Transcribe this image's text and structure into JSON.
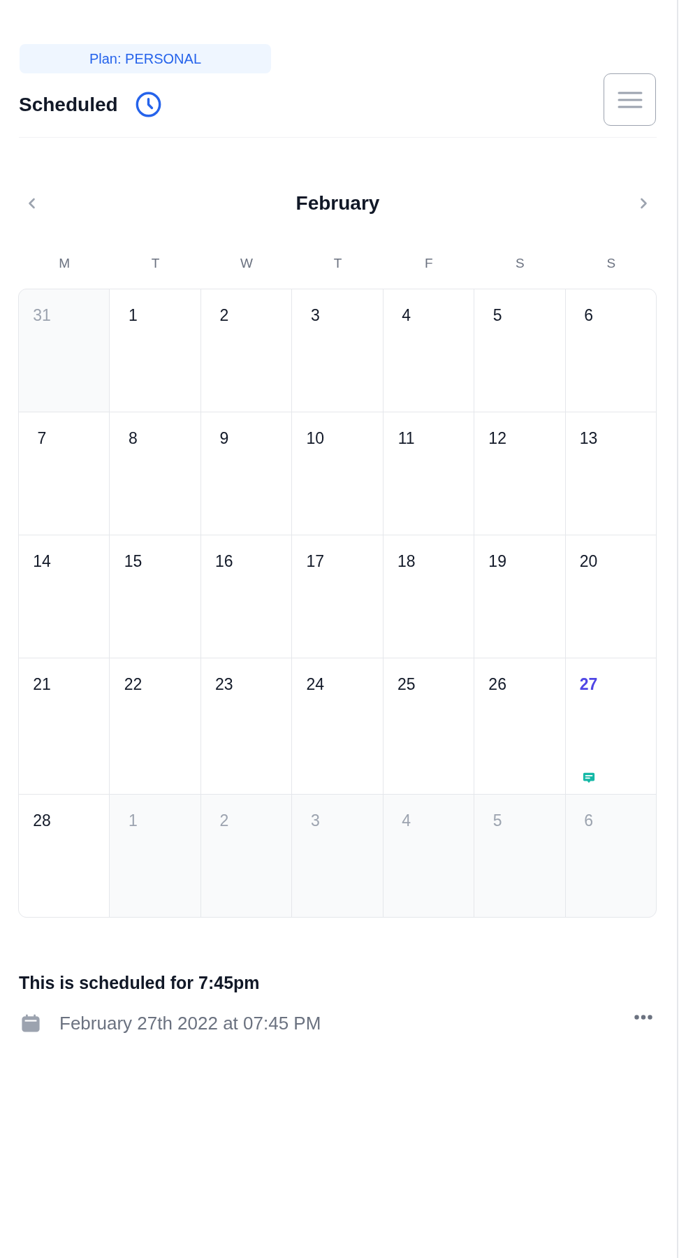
{
  "plan_badge": {
    "label": "Plan: PERSONAL"
  },
  "header": {
    "title": "Scheduled"
  },
  "calendar": {
    "month": "February",
    "weekdays": [
      "M",
      "T",
      "W",
      "T",
      "F",
      "S",
      "S"
    ],
    "weeks": [
      [
        {
          "day": "31",
          "in_month": false,
          "selected": false,
          "has_event": false
        },
        {
          "day": "1",
          "in_month": true,
          "selected": false,
          "has_event": false
        },
        {
          "day": "2",
          "in_month": true,
          "selected": false,
          "has_event": false
        },
        {
          "day": "3",
          "in_month": true,
          "selected": false,
          "has_event": false
        },
        {
          "day": "4",
          "in_month": true,
          "selected": false,
          "has_event": false
        },
        {
          "day": "5",
          "in_month": true,
          "selected": false,
          "has_event": false
        },
        {
          "day": "6",
          "in_month": true,
          "selected": false,
          "has_event": false
        }
      ],
      [
        {
          "day": "7",
          "in_month": true,
          "selected": false,
          "has_event": false
        },
        {
          "day": "8",
          "in_month": true,
          "selected": false,
          "has_event": false
        },
        {
          "day": "9",
          "in_month": true,
          "selected": false,
          "has_event": false
        },
        {
          "day": "10",
          "in_month": true,
          "selected": false,
          "has_event": false
        },
        {
          "day": "11",
          "in_month": true,
          "selected": false,
          "has_event": false
        },
        {
          "day": "12",
          "in_month": true,
          "selected": false,
          "has_event": false
        },
        {
          "day": "13",
          "in_month": true,
          "selected": false,
          "has_event": false
        }
      ],
      [
        {
          "day": "14",
          "in_month": true,
          "selected": false,
          "has_event": false
        },
        {
          "day": "15",
          "in_month": true,
          "selected": false,
          "has_event": false
        },
        {
          "day": "16",
          "in_month": true,
          "selected": false,
          "has_event": false
        },
        {
          "day": "17",
          "in_month": true,
          "selected": false,
          "has_event": false
        },
        {
          "day": "18",
          "in_month": true,
          "selected": false,
          "has_event": false
        },
        {
          "day": "19",
          "in_month": true,
          "selected": false,
          "has_event": false
        },
        {
          "day": "20",
          "in_month": true,
          "selected": false,
          "has_event": false
        }
      ],
      [
        {
          "day": "21",
          "in_month": true,
          "selected": false,
          "has_event": false
        },
        {
          "day": "22",
          "in_month": true,
          "selected": false,
          "has_event": false
        },
        {
          "day": "23",
          "in_month": true,
          "selected": false,
          "has_event": false
        },
        {
          "day": "24",
          "in_month": true,
          "selected": false,
          "has_event": false
        },
        {
          "day": "25",
          "in_month": true,
          "selected": false,
          "has_event": false
        },
        {
          "day": "26",
          "in_month": true,
          "selected": false,
          "has_event": false
        },
        {
          "day": "27",
          "in_month": true,
          "selected": true,
          "has_event": true
        }
      ],
      [
        {
          "day": "28",
          "in_month": true,
          "selected": false,
          "has_event": false
        },
        {
          "day": "1",
          "in_month": false,
          "selected": false,
          "has_event": false
        },
        {
          "day": "2",
          "in_month": false,
          "selected": false,
          "has_event": false
        },
        {
          "day": "3",
          "in_month": false,
          "selected": false,
          "has_event": false
        },
        {
          "day": "4",
          "in_month": false,
          "selected": false,
          "has_event": false
        },
        {
          "day": "5",
          "in_month": false,
          "selected": false,
          "has_event": false
        },
        {
          "day": "6",
          "in_month": false,
          "selected": false,
          "has_event": false
        }
      ]
    ]
  },
  "schedule": {
    "title": "This is scheduled for 7:45pm",
    "datetime": "February 27th 2022 at 07:45 PM"
  }
}
